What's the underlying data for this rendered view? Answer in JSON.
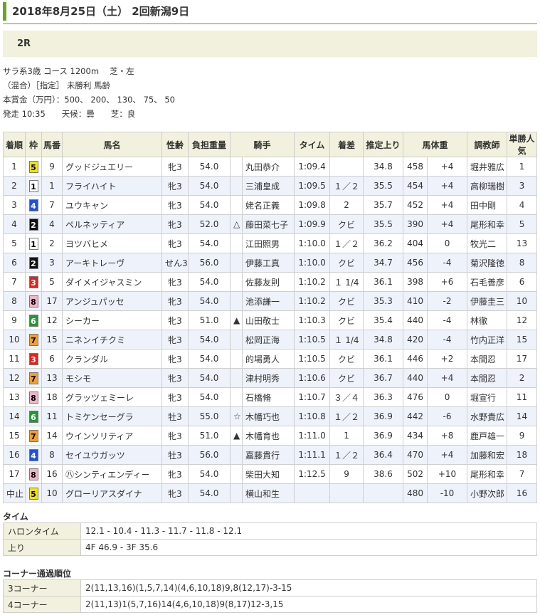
{
  "page_title": "2018年8月25日（土） 2回新潟9日",
  "race_label": "2R",
  "info_lines": [
    "サラ系3歳 コース 1200m　 芝・左",
    "（混合）［指定］ 未勝利 馬齢",
    "本賞金（万円）：500、 200、 130、 75、 50",
    "発走 10:35　　天候：曇　　芝：良"
  ],
  "headers": [
    "着順",
    "枠",
    "馬番",
    "馬名",
    "性齢",
    "負担重量",
    "騎手",
    "タイム",
    "着差",
    "推定上り",
    "馬体重",
    "調教師",
    "単勝人気"
  ],
  "rows": [
    {
      "rank": "1",
      "waku": "5",
      "num": "9",
      "name": "グッドジュエリー",
      "sex": "牝3",
      "weight": "54.0",
      "mark": "",
      "jockey": "丸田恭介",
      "time": "1:09.4",
      "margin": "",
      "last3f": "34.8",
      "bw": "458",
      "bwdiff": "+4",
      "trainer": "堀井雅広",
      "pop": "1"
    },
    {
      "rank": "2",
      "waku": "1",
      "num": "1",
      "name": "フライハイト",
      "sex": "牝3",
      "weight": "54.0",
      "mark": "",
      "jockey": "三浦皇成",
      "time": "1:09.5",
      "margin": "１／２",
      "last3f": "35.5",
      "bw": "454",
      "bwdiff": "+4",
      "trainer": "高柳瑞樹",
      "pop": "3"
    },
    {
      "rank": "3",
      "waku": "4",
      "num": "7",
      "name": "ユウキャン",
      "sex": "牝3",
      "weight": "54.0",
      "mark": "",
      "jockey": "姥名正義",
      "time": "1:09.8",
      "margin": "2",
      "last3f": "35.7",
      "bw": "452",
      "bwdiff": "+4",
      "trainer": "田中剛",
      "pop": "4"
    },
    {
      "rank": "4",
      "waku": "2",
      "num": "4",
      "name": "ペルネッティア",
      "sex": "牝3",
      "weight": "52.0",
      "mark": "△",
      "jockey": "藤田菜七子",
      "time": "1:09.9",
      "margin": "クビ",
      "last3f": "35.5",
      "bw": "390",
      "bwdiff": "+4",
      "trainer": "尾形和幸",
      "pop": "5"
    },
    {
      "rank": "5",
      "waku": "1",
      "num": "2",
      "name": "ヨツバヒメ",
      "sex": "牝3",
      "weight": "54.0",
      "mark": "",
      "jockey": "江田照男",
      "time": "1:10.0",
      "margin": "１／２",
      "last3f": "36.2",
      "bw": "404",
      "bwdiff": "0",
      "trainer": "牧光二",
      "pop": "13"
    },
    {
      "rank": "6",
      "waku": "2",
      "num": "3",
      "name": "アーキトレーヴ",
      "sex": "せん3",
      "weight": "56.0",
      "mark": "",
      "jockey": "伊藤工真",
      "time": "1:10.0",
      "margin": "クビ",
      "last3f": "34.7",
      "bw": "456",
      "bwdiff": "-4",
      "trainer": "菊沢隆徳",
      "pop": "8"
    },
    {
      "rank": "7",
      "waku": "3",
      "num": "5",
      "name": "ダイメイジャスミン",
      "sex": "牝3",
      "weight": "54.0",
      "mark": "",
      "jockey": "佐藤友則",
      "time": "1:10.2",
      "margin": "１ 1/4",
      "last3f": "36.1",
      "bw": "398",
      "bwdiff": "+6",
      "trainer": "石毛善彦",
      "pop": "6"
    },
    {
      "rank": "8",
      "waku": "8",
      "num": "17",
      "name": "アンジュパッセ",
      "sex": "牝3",
      "weight": "54.0",
      "mark": "",
      "jockey": "池添謙一",
      "time": "1:10.2",
      "margin": "クビ",
      "last3f": "35.3",
      "bw": "410",
      "bwdiff": "-2",
      "trainer": "伊藤圭三",
      "pop": "10"
    },
    {
      "rank": "9",
      "waku": "6",
      "num": "12",
      "name": "シーカー",
      "sex": "牝3",
      "weight": "51.0",
      "mark": "▲",
      "jockey": "山田敬士",
      "time": "1:10.3",
      "margin": "クビ",
      "last3f": "35.4",
      "bw": "440",
      "bwdiff": "-4",
      "trainer": "林徹",
      "pop": "12"
    },
    {
      "rank": "10",
      "waku": "7",
      "num": "15",
      "name": "ニネンイチクミ",
      "sex": "牝3",
      "weight": "54.0",
      "mark": "",
      "jockey": "松岡正海",
      "time": "1:10.5",
      "margin": "１ 1/4",
      "last3f": "34.8",
      "bw": "420",
      "bwdiff": "-4",
      "trainer": "竹内正洋",
      "pop": "15"
    },
    {
      "rank": "11",
      "waku": "3",
      "num": "6",
      "name": "クランダル",
      "sex": "牝3",
      "weight": "54.0",
      "mark": "",
      "jockey": "的場勇人",
      "time": "1:10.5",
      "margin": "クビ",
      "last3f": "36.1",
      "bw": "446",
      "bwdiff": "+2",
      "trainer": "本間忍",
      "pop": "17"
    },
    {
      "rank": "12",
      "waku": "7",
      "num": "13",
      "name": "モシモ",
      "sex": "牝3",
      "weight": "54.0",
      "mark": "",
      "jockey": "津村明秀",
      "time": "1:10.6",
      "margin": "クビ",
      "last3f": "36.7",
      "bw": "440",
      "bwdiff": "+4",
      "trainer": "本間忍",
      "pop": "2"
    },
    {
      "rank": "13",
      "waku": "8",
      "num": "18",
      "name": "グラッツェミーレ",
      "sex": "牝3",
      "weight": "54.0",
      "mark": "",
      "jockey": "石橋脩",
      "time": "1:10.7",
      "margin": "３／４",
      "last3f": "36.3",
      "bw": "476",
      "bwdiff": "0",
      "trainer": "堀宣行",
      "pop": "11"
    },
    {
      "rank": "14",
      "waku": "6",
      "num": "11",
      "name": "トミケンセーグラ",
      "sex": "牡3",
      "weight": "55.0",
      "mark": "☆",
      "jockey": "木幡巧也",
      "time": "1:10.8",
      "margin": "１／２",
      "last3f": "36.9",
      "bw": "442",
      "bwdiff": "-6",
      "trainer": "水野貴広",
      "pop": "14"
    },
    {
      "rank": "15",
      "waku": "7",
      "num": "14",
      "name": "ウインソリティア",
      "sex": "牝3",
      "weight": "51.0",
      "mark": "▲",
      "jockey": "木幡育也",
      "time": "1:11.0",
      "margin": "1",
      "last3f": "36.9",
      "bw": "434",
      "bwdiff": "+8",
      "trainer": "鹿戸雄一",
      "pop": "9"
    },
    {
      "rank": "16",
      "waku": "4",
      "num": "8",
      "name": "セイユウガッツ",
      "sex": "牡3",
      "weight": "56.0",
      "mark": "",
      "jockey": "嘉藤貴行",
      "time": "1:11.1",
      "margin": "１／２",
      "last3f": "36.4",
      "bw": "470",
      "bwdiff": "+4",
      "trainer": "加藤和宏",
      "pop": "18"
    },
    {
      "rank": "17",
      "waku": "8",
      "num": "16",
      "name": "㊇シンティエンディー",
      "sex": "牝3",
      "weight": "54.0",
      "mark": "",
      "jockey": "柴田大知",
      "time": "1:12.5",
      "margin": "9",
      "last3f": "38.6",
      "bw": "502",
      "bwdiff": "+10",
      "trainer": "尾形和幸",
      "pop": "7"
    },
    {
      "rank": "中止",
      "waku": "5",
      "num": "10",
      "name": "グローリアスダイナ",
      "sex": "牝3",
      "weight": "54.0",
      "mark": "",
      "jockey": "横山和生",
      "time": "",
      "margin": "",
      "last3f": "",
      "bw": "480",
      "bwdiff": "-10",
      "trainer": "小野次郎",
      "pop": "16"
    }
  ],
  "waku_colors": {
    "1": {
      "bg": "#ffffff",
      "fg": "#000000"
    },
    "2": {
      "bg": "#111111",
      "fg": "#ffffff"
    },
    "3": {
      "bg": "#e8211b",
      "fg": "#ffffff"
    },
    "4": {
      "bg": "#1e50e0",
      "fg": "#ffffff"
    },
    "5": {
      "bg": "#f5e500",
      "fg": "#000000"
    },
    "6": {
      "bg": "#1e9a2e",
      "fg": "#ffffff"
    },
    "7": {
      "bg": "#f5a023",
      "fg": "#000000"
    },
    "8": {
      "bg": "#f7b3c6",
      "fg": "#000000"
    }
  },
  "time_section": {
    "title": "タイム",
    "rows": [
      {
        "label": "ハロンタイム",
        "value": "12.1 - 10.4 - 11.3 - 11.7 - 11.8 - 12.1"
      },
      {
        "label": "上り",
        "value": "4F 46.9 - 3F 35.6"
      }
    ]
  },
  "corner_section": {
    "title": "コーナー通過順位",
    "rows": [
      {
        "label": "3コーナー",
        "value": "2(11,13,16)(1,5,7,14)(4,6,10,18)9,8(12,17)-3-15"
      },
      {
        "label": "4コーナー",
        "value": "2(11,13)1(5,7,16)14(4,6,10,18)9(8,17)12-3,15"
      }
    ]
  }
}
